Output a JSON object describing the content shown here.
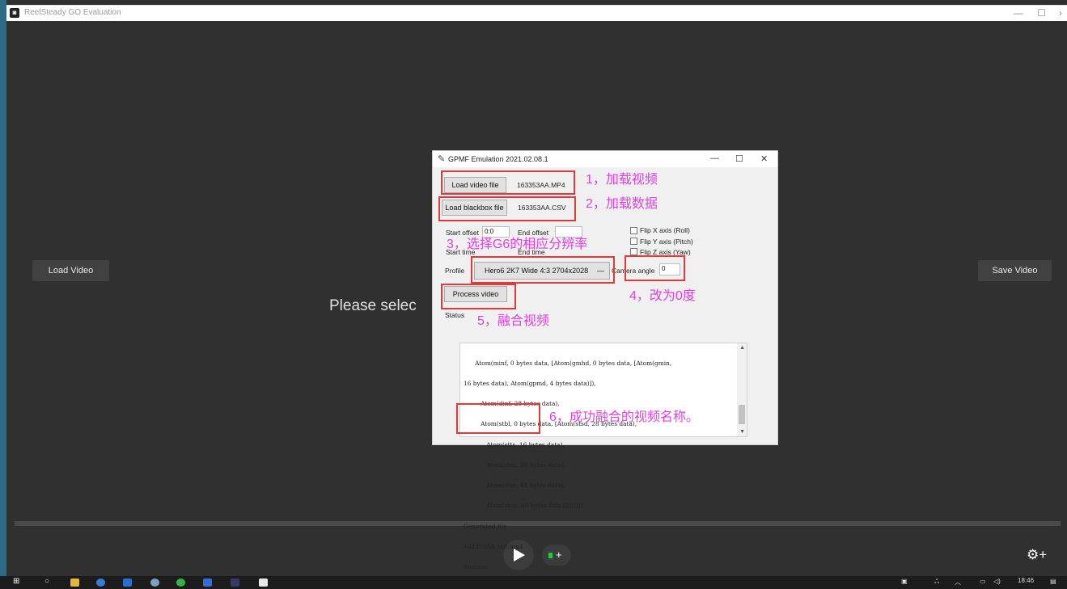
{
  "app": {
    "title": "ReelSteady GO Evaluation",
    "load_video_label": "Load Video",
    "save_video_label": "Save Video",
    "placeholder_text": "Please selec"
  },
  "dialog": {
    "title": "GPMF Emulation 2021.02.08.1",
    "load_video_button": "Load video file",
    "video_file_name": "163353AA.MP4",
    "load_blackbox_button": "Load blackbox file",
    "blackbox_file_name": "163353AA.CSV",
    "start_offset_label": "Start offset",
    "start_offset_value": "0:0",
    "end_offset_label": "End offset",
    "end_offset_value": "",
    "start_time_label": "Start time",
    "end_time_label": "End time",
    "flip_x_label": "Flip X axis (Roll)",
    "flip_y_label": "Flip Y axis (Pitch)",
    "flip_z_label": "Flip Z axis (Yaw)",
    "profile_label": "Profile",
    "profile_value": "Hero6 2K7 Wide 4:3 2704x2028",
    "camera_angle_label": "Camera angle",
    "camera_angle_value": "0",
    "process_button": "Process video",
    "status_label": "Status",
    "log_lines": [
      "      Atom(minf, 0 bytes data, [Atom(gmhd, 0 bytes data, [Atom(gmin,",
      "16 bytes data), Atom(gpmd, 4 bytes data)]),",
      "         Atom(dinf, 28 bytes data),",
      "         Atom(stbl, 0 bytes data, [Atom(stsd, 28 bytes data),",
      "            Atom(stts, 16 bytes data),",
      "            Atom(stsc, 20 bytes data),",
      "            Atom(stsz, 44 bytes data),",
      "            Atom(stco, 40 bytes data)])])])])",
      "Generated file",
      "163353AA_out.mp4",
      "Success"
    ]
  },
  "annotations": {
    "step1": "1，加载视频",
    "step2": "2，加载数据",
    "step3": "3，选择G6的相应分辨率",
    "step4": "4，改为0度",
    "step5": "5，融合视频",
    "step6": "6，成功融合的视频名称。"
  },
  "taskbar": {
    "clock": "18:46"
  },
  "colors": {
    "annotation_box": "#e23a3a",
    "annotation_text": "#e040e0",
    "app_background": "#303030",
    "taskbar": "#1c1c1c"
  }
}
